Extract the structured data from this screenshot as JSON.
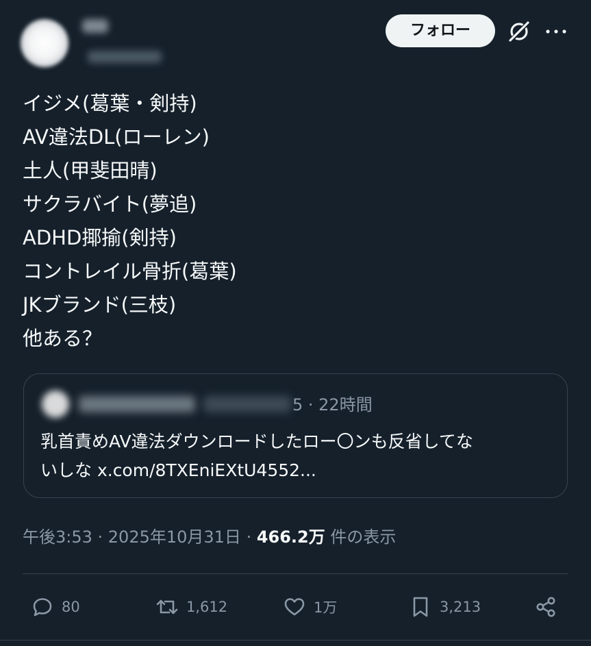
{
  "header": {
    "follow_label": "フォロー"
  },
  "post": {
    "lines": [
      "イジメ(葛葉・剣持)",
      "AV違法DL(ローレン)",
      "土人(甲斐田晴)",
      "サクラバイト(夢追)",
      "ADHD揶揄(剣持)",
      "コントレイル骨折(葛葉)",
      "JKブランド(三枝)",
      "他ある？"
    ]
  },
  "quote": {
    "handle_tail": "5 · 22時間",
    "text_line1": "乳首責めAV違法ダウンロードしたロー〇ンも反省してな",
    "text_line2": "いしな x.com/8TXEniEXtU4552..."
  },
  "meta": {
    "time_date": "午後3:53 · 2025年10月31日 · ",
    "views_count": "466.2万",
    "views_label": " 件の表示"
  },
  "actions": {
    "replies": "80",
    "reposts": "1,612",
    "likes": "1万",
    "bookmarks": "3,213"
  },
  "colors": {
    "background": "#15202b",
    "text_primary": "#f7f9f9",
    "text_secondary": "#8b98a5",
    "border": "#38444d",
    "follow_button_bg": "#eff3f4"
  },
  "icons": [
    "grok-icon",
    "more-icon",
    "reply-icon",
    "repost-icon",
    "like-icon",
    "bookmark-icon",
    "share-icon"
  ]
}
